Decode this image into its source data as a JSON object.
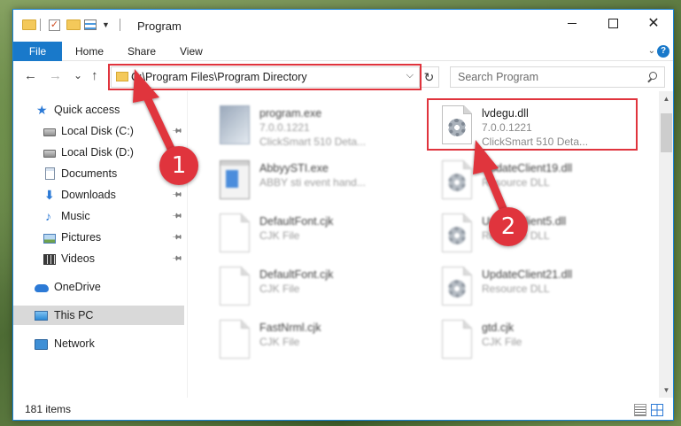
{
  "window": {
    "title": "Program",
    "minimize_glyph": "",
    "close_glyph": "✕"
  },
  "ribbon": {
    "tabs": [
      {
        "label": "File"
      },
      {
        "label": "Home"
      },
      {
        "label": "Share"
      },
      {
        "label": "View"
      }
    ],
    "help_glyph": "?"
  },
  "nav": {
    "back_glyph": "←",
    "forward_glyph": "→",
    "recent_glyph": "⌄",
    "up_glyph": "↑",
    "address": "C:\\Program Files\\Program Directory",
    "refresh_glyph": "↻",
    "search_placeholder": "Search Program"
  },
  "sidebar": {
    "items": [
      {
        "label": "Quick access",
        "icon": "star-icon",
        "pinned": false
      },
      {
        "label": "Local Disk (C:)",
        "icon": "drive-icon",
        "pinned": true
      },
      {
        "label": "Local Disk (D:)",
        "icon": "drive-icon",
        "pinned": false
      },
      {
        "label": "Documents",
        "icon": "document-icon",
        "pinned": true
      },
      {
        "label": "Downloads",
        "icon": "download-icon",
        "pinned": true
      },
      {
        "label": "Music",
        "icon": "music-icon",
        "pinned": true
      },
      {
        "label": "Pictures",
        "icon": "pictures-icon",
        "pinned": true
      },
      {
        "label": "Videos",
        "icon": "video-icon",
        "pinned": true
      },
      {
        "label": "OneDrive",
        "icon": "cloud-icon",
        "pinned": false
      },
      {
        "label": "This PC",
        "icon": "computer-icon",
        "pinned": false,
        "selected": true
      },
      {
        "label": "Network",
        "icon": "network-icon",
        "pinned": false
      }
    ],
    "pin_glyph": "📌"
  },
  "files": [
    {
      "name": "program.exe",
      "line1": "7.0.0.1221",
      "line2": "ClickSmart 510 Deta...",
      "icon": "exe-icon"
    },
    {
      "name": "lvdegu.dll",
      "line1": "7.0.0.1221",
      "line2": "ClickSmart 510 Deta...",
      "icon": "dll-gear-icon",
      "highlighted": true
    },
    {
      "name": "AbbyySTI.exe",
      "line1": "ABBY sti event hand...",
      "line2": "",
      "icon": "exe-icon"
    },
    {
      "name": "UpdateClient19.dll",
      "line1": "Resource DLL",
      "line2": "",
      "icon": "dll-gear-icon"
    },
    {
      "name": "DefaultFont.cjk",
      "line1": "CJK File",
      "line2": "",
      "icon": "blank-file-icon"
    },
    {
      "name": "UpdateClient5.dll",
      "line1": "Resource DLL",
      "line2": "",
      "icon": "dll-gear-icon"
    },
    {
      "name": "DefaultFont.cjk",
      "line1": "CJK File",
      "line2": "",
      "icon": "blank-file-icon"
    },
    {
      "name": "UpdateClient21.dll",
      "line1": "Resource DLL",
      "line2": "",
      "icon": "dll-gear-icon"
    },
    {
      "name": "FastNrml.cjk",
      "line1": "CJK File",
      "line2": "",
      "icon": "blank-file-icon"
    },
    {
      "name": "gtd.cjk",
      "line1": "CJK File",
      "line2": "",
      "icon": "blank-file-icon"
    }
  ],
  "status": {
    "item_count": "181 items"
  },
  "annotations": {
    "step1": "1",
    "step2": "2",
    "color": "#e0343d"
  },
  "colors": {
    "accent": "#1979ca",
    "highlight_border": "#e0343d"
  }
}
